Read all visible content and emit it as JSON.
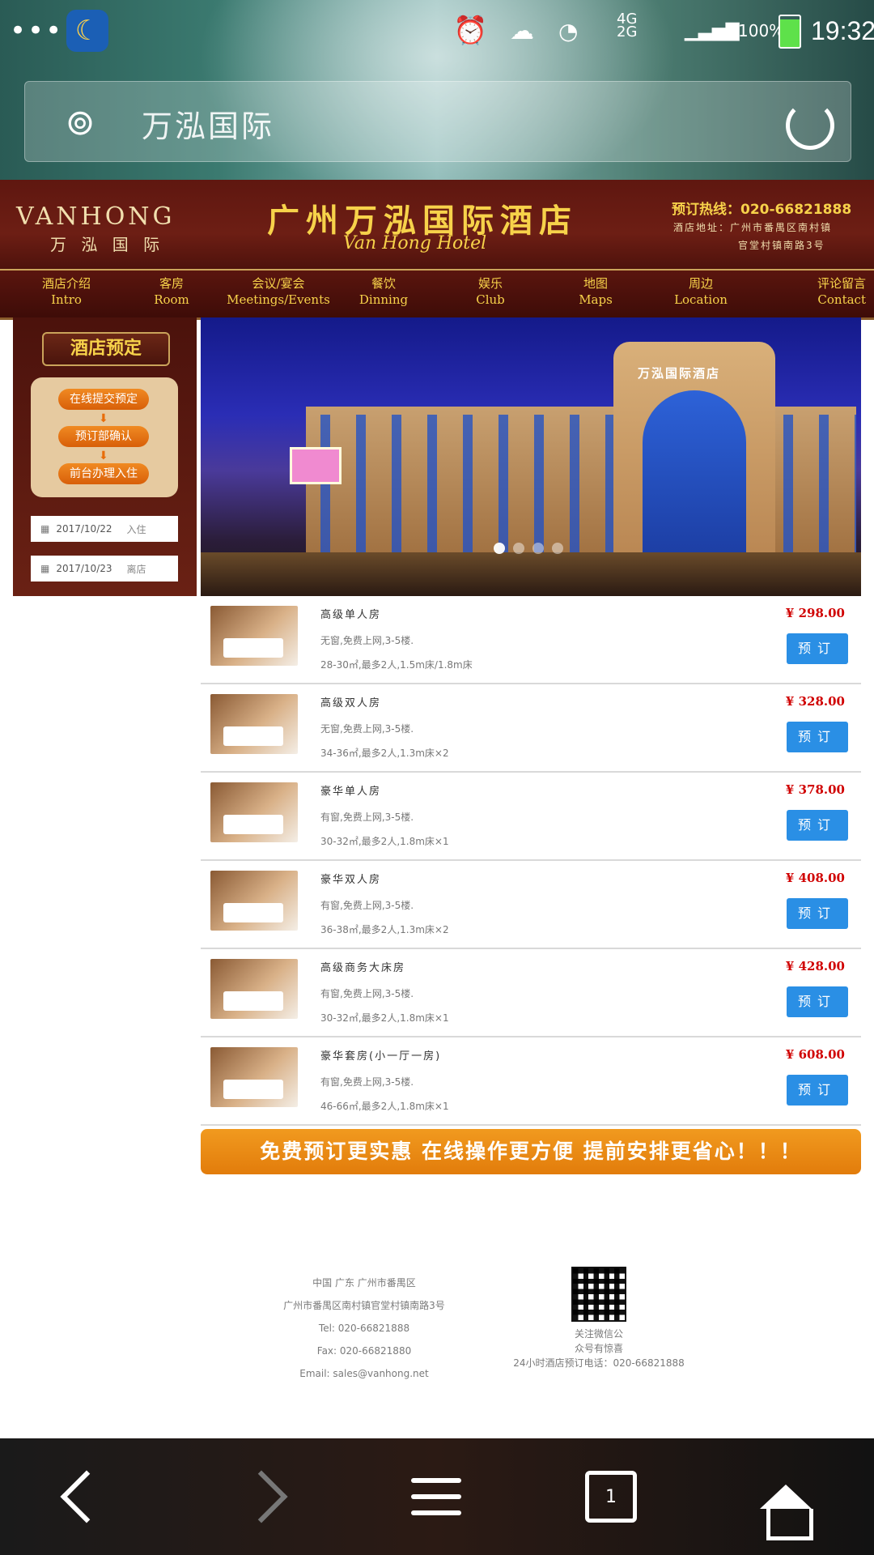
{
  "status_bar": {
    "time": "19:32",
    "battery": "100%",
    "network": "4G",
    "network2": "2G"
  },
  "search": {
    "query": "万泓国际"
  },
  "header": {
    "brand_en": "VANHONG",
    "brand_cn": "万 泓 国 际",
    "title": "广州万泓国际酒店",
    "subtitle": "Van Hong Hotel",
    "hotline": "预订热线：020-66821888",
    "address_line1": "酒店地址：广州市番禺区南村镇",
    "address_line2": "官堂村镇南路3号"
  },
  "nav": [
    {
      "cn": "酒店介绍",
      "en": "Intro"
    },
    {
      "cn": "客房",
      "en": "Room"
    },
    {
      "cn": "会议/宴会",
      "en": "Meetings/Events"
    },
    {
      "cn": "餐饮",
      "en": "Dinning"
    },
    {
      "cn": "娱乐",
      "en": "Club"
    },
    {
      "cn": "地图",
      "en": "Maps"
    },
    {
      "cn": "周边",
      "en": "Location"
    },
    {
      "cn": "评论留言",
      "en": "Contact"
    }
  ],
  "booking": {
    "title": "酒店预定",
    "steps": [
      "在线提交预定",
      "预订部确认",
      "前台办理入住"
    ],
    "checkin_date": "2017/10/22",
    "checkin_label": "入住",
    "checkout_date": "2017/10/23",
    "checkout_label": "离店"
  },
  "banner": {
    "sign_text": "万泓国际酒店",
    "slides": 4,
    "active_slide": 1
  },
  "rooms": [
    {
      "name": "高级单人房",
      "desc1": "无窗,免费上网,3-5楼.",
      "desc2": "28-30㎡,最多2人,1.5m床/1.8m床",
      "price": "¥ 298.00",
      "button": "预订"
    },
    {
      "name": "高级双人房",
      "desc1": "无窗,免费上网,3-5楼.",
      "desc2": "34-36㎡,最多2人,1.3m床×2",
      "price": "¥ 328.00",
      "button": "预订"
    },
    {
      "name": "豪华单人房",
      "desc1": "有窗,免费上网,3-5楼.",
      "desc2": "30-32㎡,最多2人,1.8m床×1",
      "price": "¥ 378.00",
      "button": "预订"
    },
    {
      "name": "豪华双人房",
      "desc1": "有窗,免费上网,3-5楼.",
      "desc2": "36-38㎡,最多2人,1.3m床×2",
      "price": "¥ 408.00",
      "button": "预订"
    },
    {
      "name": "高级商务大床房",
      "desc1": "有窗,免费上网,3-5楼.",
      "desc2": "30-32㎡,最多2人,1.8m床×1",
      "price": "¥ 428.00",
      "button": "预订"
    },
    {
      "name": "豪华套房(小一厅一房)",
      "desc1": "有窗,免费上网,3-5楼.",
      "desc2": "46-66㎡,最多2人,1.8m床×1",
      "price": "¥ 608.00",
      "button": "预订"
    }
  ],
  "promo": {
    "text": "免费预订更实惠 在线操作更方便 提前安排更省心！！！"
  },
  "footer": {
    "line1": "中国 广东 广州市番禺区",
    "line2": "广州市番禺区南村镇官堂村镇南路3号",
    "tel": "Tel: 020-66821888",
    "fax": "Fax: 020-66821880",
    "email": "Email: sales@vanhong.net",
    "qr_caption1": "关注微信公",
    "qr_caption2": "众号有惊喜",
    "hotline_24h": "24小时酒店预订电话：020-66821888"
  },
  "browser_bar": {
    "tab_count": "1"
  },
  "colors": {
    "header_bg": "#5f1710",
    "gold": "#f7d24a",
    "price_red": "#d00000",
    "button_blue": "#2a8fe5",
    "promo_orange": "#e88a12"
  }
}
